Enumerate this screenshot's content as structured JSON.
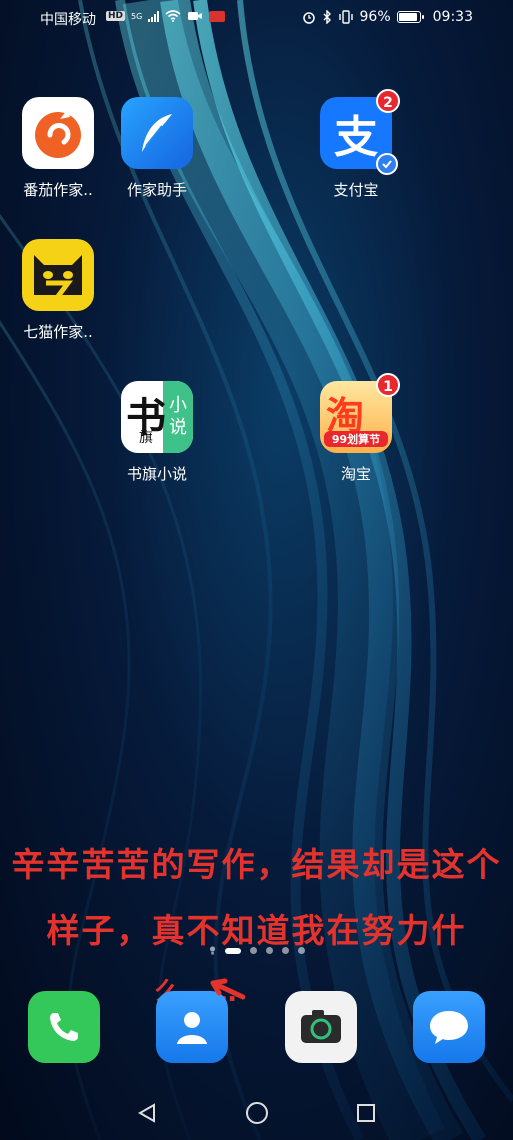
{
  "status_bar": {
    "carrier": "中国移动",
    "hd_label": "HD",
    "network_label": "5G",
    "battery": "96%",
    "battery_level": 0.96,
    "time": "09:33"
  },
  "apps": [
    {
      "label": "番茄作家..",
      "icon": "fanqie-writer-icon",
      "color": "#f06125"
    },
    {
      "label": "作家助手",
      "icon": "writer-assistant-icon",
      "color": "#1e8ef0"
    },
    {
      "label": "支付宝",
      "icon": "alipay-icon",
      "color": "#1677ff",
      "badge": "2"
    },
    {
      "label": "七猫作家..",
      "icon": "qimao-writer-icon",
      "color": "#f5d216"
    },
    {
      "label": "书旗小说",
      "icon": "shuqi-icon",
      "color": "#3fc28a",
      "icon_text_main": "书",
      "icon_text_sub": "旗",
      "icon_text_side": "小说"
    },
    {
      "label": "淘宝",
      "icon": "taobao-icon",
      "color": "#ff5a1f",
      "badge": "1",
      "icon_text_main": "淘",
      "icon_text_sub": "99划算节"
    }
  ],
  "caption": {
    "line1": "辛辛苦苦的写作，结果却是这个",
    "line2": "样子，真不知道我在努力什",
    "line3": "么……"
  },
  "page_indicator": {
    "total": 5,
    "active": 1
  },
  "dock": [
    {
      "icon": "phone-icon",
      "color": "#34c759"
    },
    {
      "icon": "contacts-icon",
      "color": "#1e90ff"
    },
    {
      "icon": "camera-icon",
      "color": "#f2f2f2"
    },
    {
      "icon": "messages-icon",
      "color": "#1e90ff"
    }
  ],
  "nav": {
    "back": "back-icon",
    "home": "home-icon",
    "recents": "recents-icon"
  }
}
